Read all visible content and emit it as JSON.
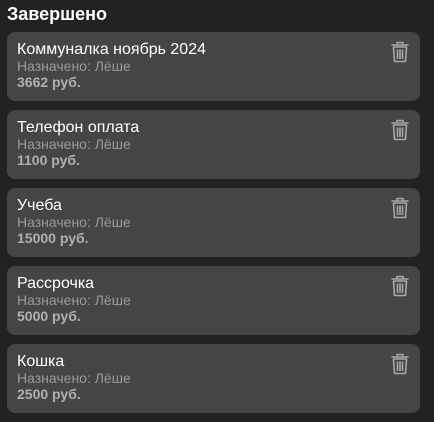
{
  "section": {
    "title": "Завершено"
  },
  "tasks": [
    {
      "title": "Коммуналка ноябрь 2024",
      "assignee": "Назначено: Лёше",
      "amount": "3662 руб."
    },
    {
      "title": "Телефон оплата",
      "assignee": "Назначено: Лёше",
      "amount": "1100 руб."
    },
    {
      "title": "Учеба",
      "assignee": "Назначено: Лёше",
      "amount": "15000 руб."
    },
    {
      "title": "Рассрочка",
      "assignee": "Назначено: Лёше",
      "amount": "5000 руб."
    },
    {
      "title": "Кошка",
      "assignee": "Назначено: Лёше",
      "amount": "2500 руб."
    }
  ],
  "icons": {
    "delete": "trash-icon"
  },
  "colors": {
    "background": "#222222",
    "card": "#454545",
    "title": "#ffffff",
    "muted": "#9a9a9a",
    "icon": "#a8a8a8"
  }
}
